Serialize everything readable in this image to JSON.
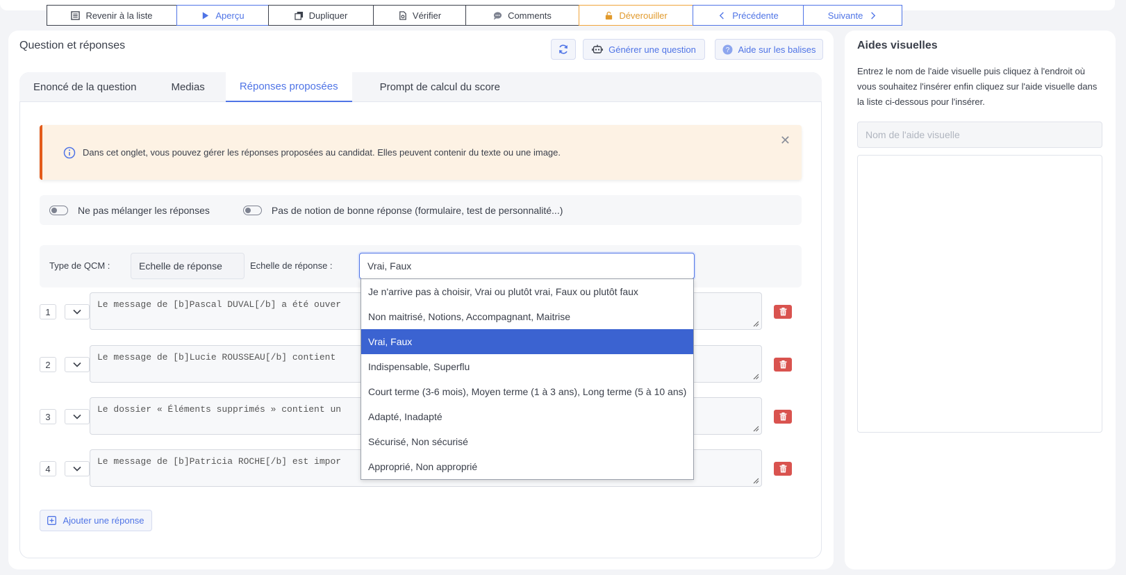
{
  "toolbar": {
    "back_label": "Revenir à la liste",
    "preview_label": "Aperçu",
    "duplicate_label": "Dupliquer",
    "verify_label": "Vérifier",
    "comments_label": "Comments",
    "unlock_label": "Déverouiller",
    "previous_label": "Précédente",
    "next_label": "Suivante"
  },
  "main": {
    "title": "Question et réponses",
    "generate_label": "Générer une question",
    "help_label": "Aide sur les balises",
    "tabs": [
      {
        "label": "Enoncé de la question"
      },
      {
        "label": "Medias"
      },
      {
        "label": "Réponses proposées"
      },
      {
        "label": "Prompt de calcul du score"
      }
    ],
    "info_text": "Dans cet onglet, vous pouvez gérer les réponses proposées au candidat. Elles peuvent contenir du texte ou une image.",
    "toggle_shuffle": "Ne pas mélanger les réponses",
    "toggle_no_correct": "Pas de notion de bonne réponse (formulaire, test de personnalité...)",
    "qcm_type_label": "Type de QCM :",
    "qcm_type_value": "Echelle de réponse",
    "scale_label": "Echelle de réponse :",
    "scale_value": "Vrai, Faux",
    "answers": [
      {
        "num": "1",
        "text": "Le message de [b]Pascal DUVAL[/b] a été ouver"
      },
      {
        "num": "2",
        "text": "Le message de [b]Lucie ROUSSEAU[/b] contient "
      },
      {
        "num": "3",
        "text": "Le dossier « Éléments supprimés » contient un"
      },
      {
        "num": "4",
        "text": "Le message de [b]Patricia ROCHE[/b] est impor"
      }
    ],
    "add_label": "Ajouter une réponse"
  },
  "dropdown": {
    "options": [
      "Je n'arrive pas à choisir, Vrai ou plutôt vrai, Faux ou plutôt faux",
      "Non maitrisé, Notions, Accompagnant, Maitrise",
      "Vrai, Faux",
      "Indispensable, Superflu",
      "Court terme (3-6 mois), Moyen terme (1 à 3 ans), Long terme (5 à 10 ans)",
      "Adapté, Inadapté",
      "Sécurisé, Non sécurisé",
      "Approprié, Non approprié"
    ],
    "selected_index": 2
  },
  "side": {
    "title": "Aides visuelles",
    "description": "Entrez le nom de l'aide visuelle puis cliquez à l'endroit où vous souhaitez l'insérer enfin cliquez sur l'aide visuelle dans la liste ci-dessous pour l'insérer.",
    "input_placeholder": "Nom de l'aide visuelle"
  },
  "colors": {
    "accent": "#4f74e6",
    "warning": "#e19a2d",
    "danger": "#d9534f",
    "selected": "#3b63d1"
  }
}
